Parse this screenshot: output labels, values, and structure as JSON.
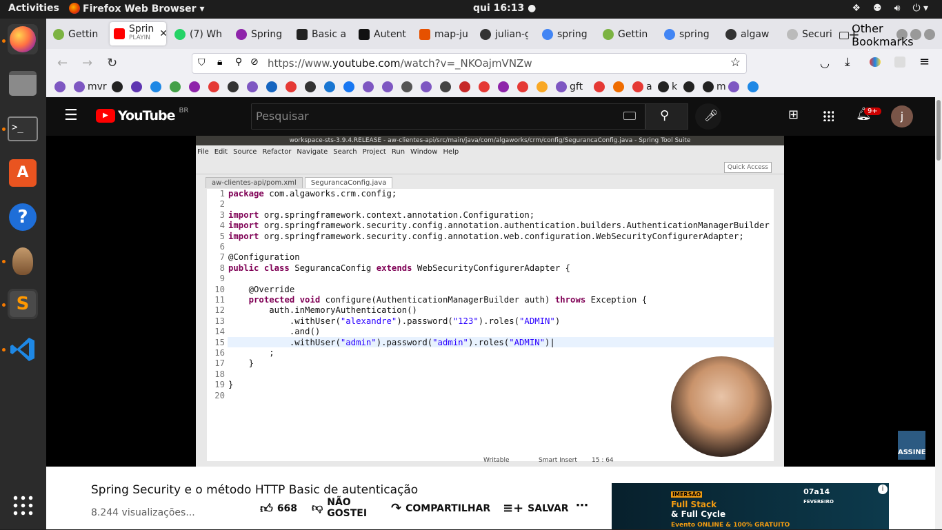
{
  "topbar": {
    "activities": "Activities",
    "app_name": "Firefox Web Browser",
    "clock": "qui 16:13"
  },
  "browser": {
    "tabs": [
      {
        "label": "Gettin",
        "color": "#7cb342"
      },
      {
        "label": "Sprin",
        "sub": "PLAYIN",
        "color": "#ff0000",
        "active": true
      },
      {
        "label": "(7) Wh",
        "color": "#25d366"
      },
      {
        "label": "Spring",
        "color": "#8e24aa"
      },
      {
        "label": "Basic a",
        "color": "#222222"
      },
      {
        "label": "Autent",
        "color": "#111111"
      },
      {
        "label": "map-ju",
        "color": "#e65100"
      },
      {
        "label": "julian-g",
        "color": "#333333"
      },
      {
        "label": "spring",
        "color": "#4285f4"
      },
      {
        "label": "Gettin",
        "color": "#7cb342"
      },
      {
        "label": "spring",
        "color": "#4285f4"
      },
      {
        "label": "algaw",
        "color": "#333333"
      },
      {
        "label": "Securi",
        "color": "#999999"
      }
    ],
    "url_prefix": "https://www.",
    "url_domain": "youtube.com",
    "url_path": "/watch?v=_NKOajmVNZw",
    "bookmarks": {
      "items": [
        {
          "label": "",
          "color": "#7e57c2"
        },
        {
          "label": "mvr",
          "color": "#7e57c2"
        },
        {
          "label": "",
          "color": "#222222"
        },
        {
          "label": "",
          "color": "#5e35b1"
        },
        {
          "label": "",
          "color": "#1e88e5"
        },
        {
          "label": "",
          "color": "#43a047"
        },
        {
          "label": "",
          "color": "#8e24aa"
        },
        {
          "label": "",
          "color": "#e53935"
        },
        {
          "label": "",
          "color": "#333333"
        },
        {
          "label": "",
          "color": "#7e57c2"
        },
        {
          "label": "",
          "color": "#1565c0"
        },
        {
          "label": "",
          "color": "#e53935"
        },
        {
          "label": "",
          "color": "#333333"
        },
        {
          "label": "",
          "color": "#1976d2"
        },
        {
          "label": "",
          "color": "#1877f2"
        },
        {
          "label": "",
          "color": "#7e57c2"
        },
        {
          "label": "",
          "color": "#7e57c2"
        },
        {
          "label": "",
          "color": "#555555"
        },
        {
          "label": "",
          "color": "#7e57c2"
        },
        {
          "label": "",
          "color": "#444444"
        },
        {
          "label": "",
          "color": "#c62828"
        },
        {
          "label": "",
          "color": "#e53935"
        },
        {
          "label": "",
          "color": "#8e24aa"
        },
        {
          "label": "",
          "color": "#e53935"
        },
        {
          "label": "",
          "color": "#f9a825"
        },
        {
          "label": "gft",
          "color": "#7e57c2"
        },
        {
          "label": "",
          "color": "#e53935"
        },
        {
          "label": "",
          "color": "#ef6c00"
        },
        {
          "label": "a",
          "color": "#e53935"
        },
        {
          "label": "k",
          "color": "#222222"
        },
        {
          "label": "",
          "color": "#222222"
        },
        {
          "label": "m",
          "color": "#222222"
        },
        {
          "label": "",
          "color": "#7e57c2"
        },
        {
          "label": "",
          "color": "#1e88e5"
        }
      ],
      "other": "Other Bookmarks"
    }
  },
  "youtube": {
    "logo_text": "YouTube",
    "country": "BR",
    "search_placeholder": "Pesquisar",
    "notification_count": "9+",
    "avatar_letter": "j",
    "video_title": "Spring Security e o método HTTP Basic de autenticação",
    "views": "8.244 visualizações...",
    "likes": "668",
    "dislike": "NÃO GOSTEI",
    "share": "COMPARTILHAR",
    "save": "SALVAR",
    "overlay_badge": "ASSINE",
    "ad": {
      "tag": "IMERSÃO",
      "line1": "Full Stack",
      "line2": "& Full Cycle",
      "line3": "Evento ONLINE & 100% GRATUITO",
      "date": "07a14",
      "month": "FEVEREIRO"
    }
  },
  "ide": {
    "title": "workspace-sts-3.9.4.RELEASE - aw-clientes-api/src/main/java/com/algaworks/crm/config/SegurancaConfig.java - Spring Tool Suite",
    "menu": [
      "File",
      "Edit",
      "Source",
      "Refactor",
      "Navigate",
      "Search",
      "Project",
      "Run",
      "Window",
      "Help"
    ],
    "quick_access": "Quick Access",
    "tabs": [
      "aw-clientes-api/pom.xml",
      "SegurancaConfig.java"
    ],
    "status": [
      "Writable",
      "Smart Insert",
      "15 : 64"
    ]
  }
}
